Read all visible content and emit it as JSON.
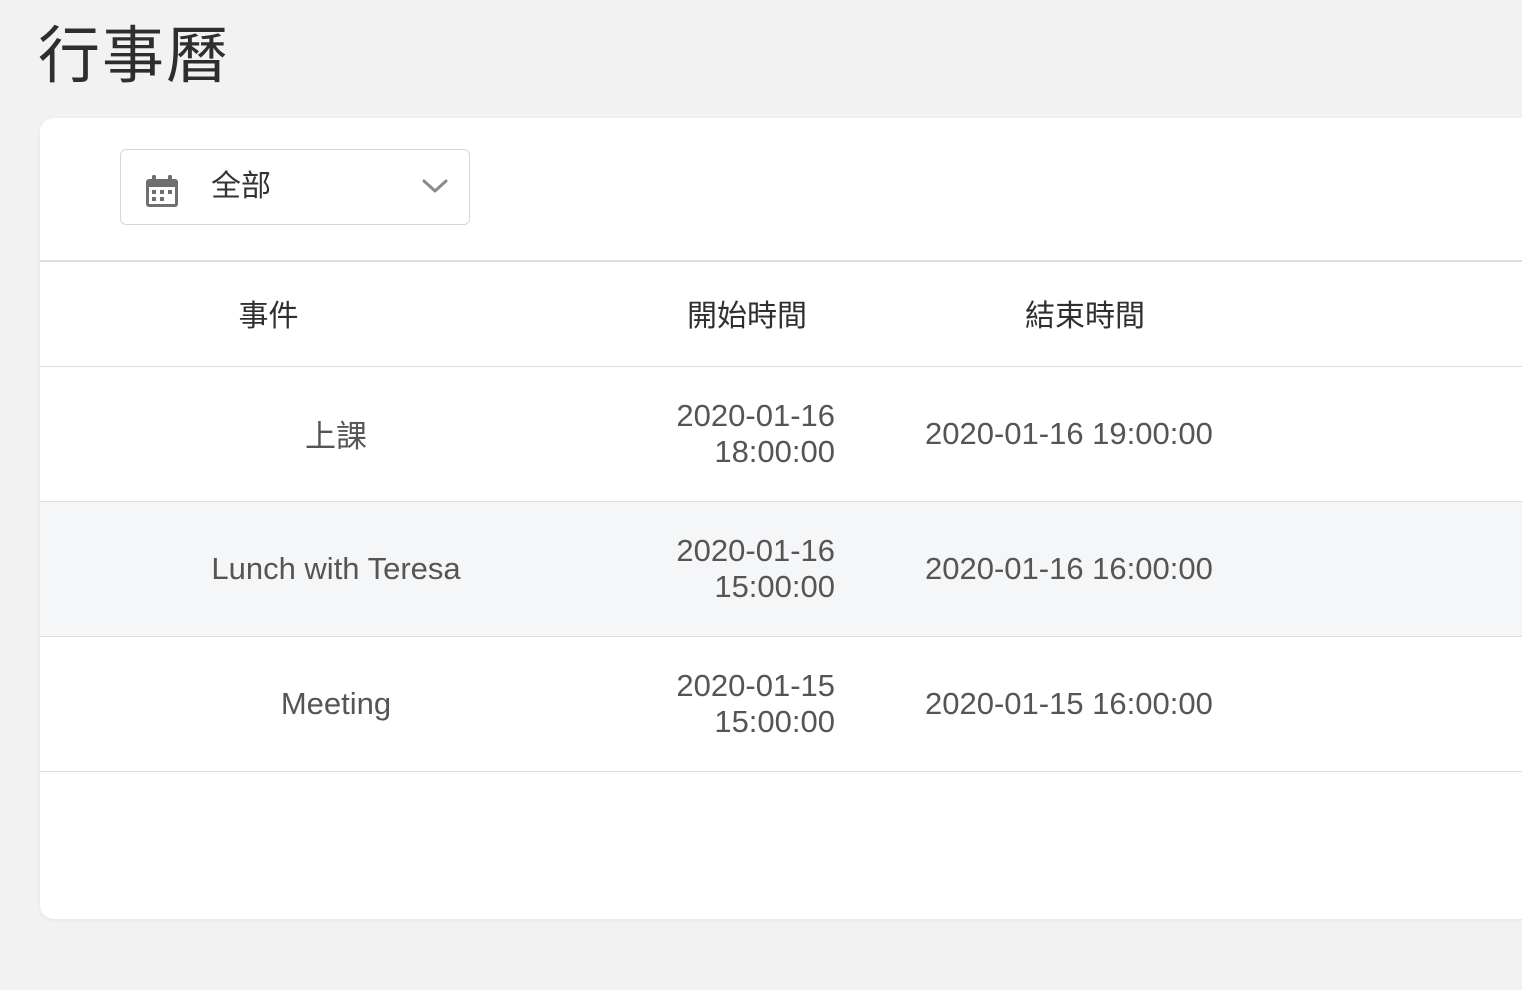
{
  "page": {
    "title": "行事曆"
  },
  "filter": {
    "selected": "全部",
    "icon": "calendar-icon",
    "toggle_icon": "chevron-down-icon"
  },
  "table": {
    "headers": [
      "事件",
      "開始時間",
      "結束時間"
    ],
    "rows": [
      {
        "event": "上課",
        "start": "2020-01-16 18:00:00",
        "end": "2020-01-16 19:00:00"
      },
      {
        "event": "Lunch with Teresa",
        "start": "2020-01-16 15:00:00",
        "end": "2020-01-16 16:00:00"
      },
      {
        "event": "Meeting",
        "start": "2020-01-15 15:00:00",
        "end": "2020-01-15 16:00:00"
      }
    ]
  },
  "colors": {
    "background": "#f2f2f3",
    "card": "#ffffff",
    "alt_row": "#f5f6f8",
    "text": "#555555",
    "divider": "#dcdcdc"
  }
}
